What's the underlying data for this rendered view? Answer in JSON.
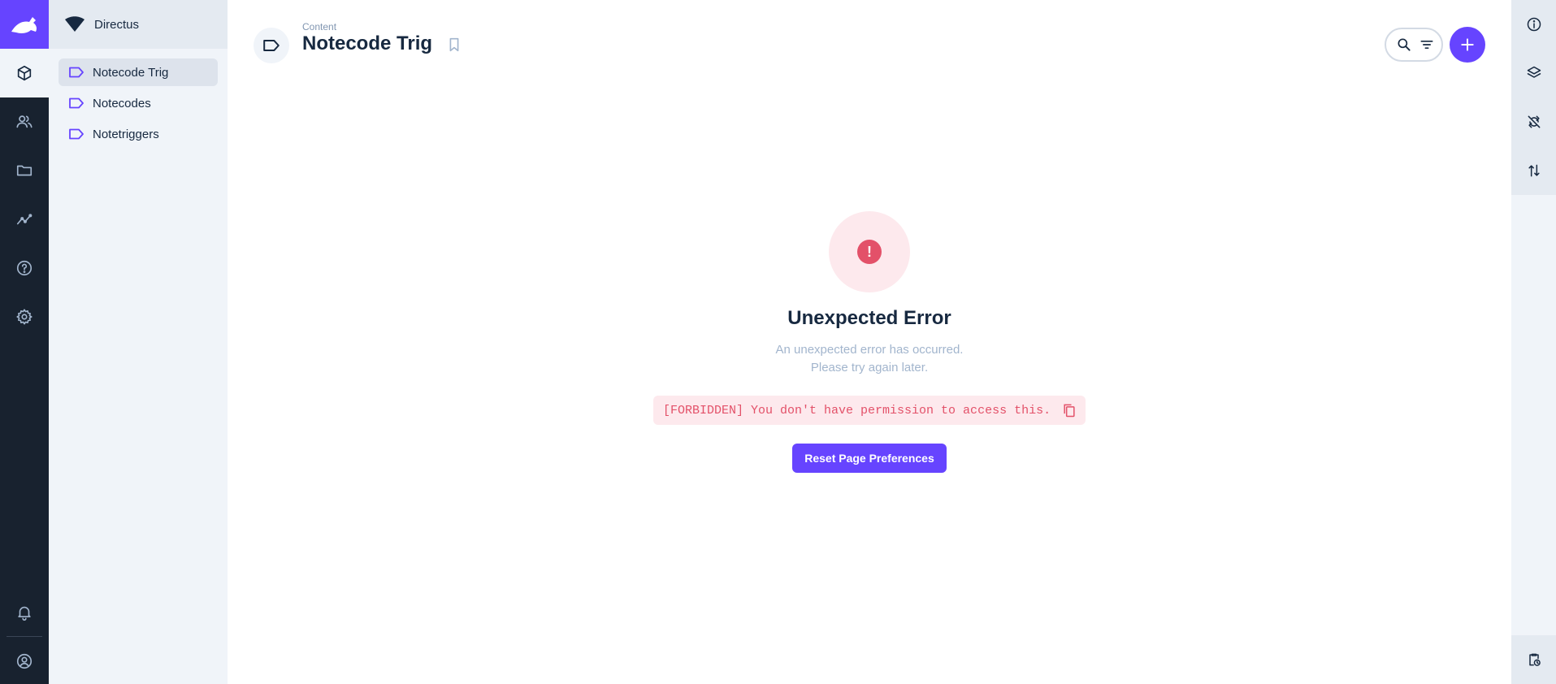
{
  "app": {
    "brand_color": "#6644ff",
    "project_name": "Directus"
  },
  "module_bar": {
    "items": [
      {
        "name": "content",
        "icon": "box-icon",
        "active": true
      },
      {
        "name": "users",
        "icon": "users-icon"
      },
      {
        "name": "files",
        "icon": "folder-icon"
      },
      {
        "name": "insights",
        "icon": "insights-icon"
      },
      {
        "name": "help",
        "icon": "help-icon"
      },
      {
        "name": "settings",
        "icon": "gear-icon"
      }
    ],
    "bottom": [
      {
        "name": "notifications",
        "icon": "bell-icon"
      },
      {
        "name": "user-menu",
        "icon": "account-icon"
      }
    ]
  },
  "navigation": {
    "items": [
      {
        "label": "Notecode Trig",
        "icon": "label-icon",
        "active": true
      },
      {
        "label": "Notecodes",
        "icon": "label-icon"
      },
      {
        "label": "Notetriggers",
        "icon": "label-icon"
      }
    ]
  },
  "header": {
    "breadcrumb": "Content",
    "title": "Notecode Trig",
    "icons": [
      "label-icon",
      "bookmark-icon",
      "search-icon",
      "filter-icon",
      "add-icon"
    ]
  },
  "error": {
    "title": "Unexpected Error",
    "description_line1": "An unexpected error has occurred.",
    "description_line2": "Please try again later.",
    "code": "[FORBIDDEN] You don't have permission to access this.",
    "button_label": "Reset Page Preferences",
    "color": "#e35169"
  },
  "sidebar": {
    "items": [
      "info-icon",
      "layers-icon",
      "sync-off-icon",
      "import-export-icon"
    ],
    "bottom": [
      "clipboard-clock-icon"
    ]
  }
}
